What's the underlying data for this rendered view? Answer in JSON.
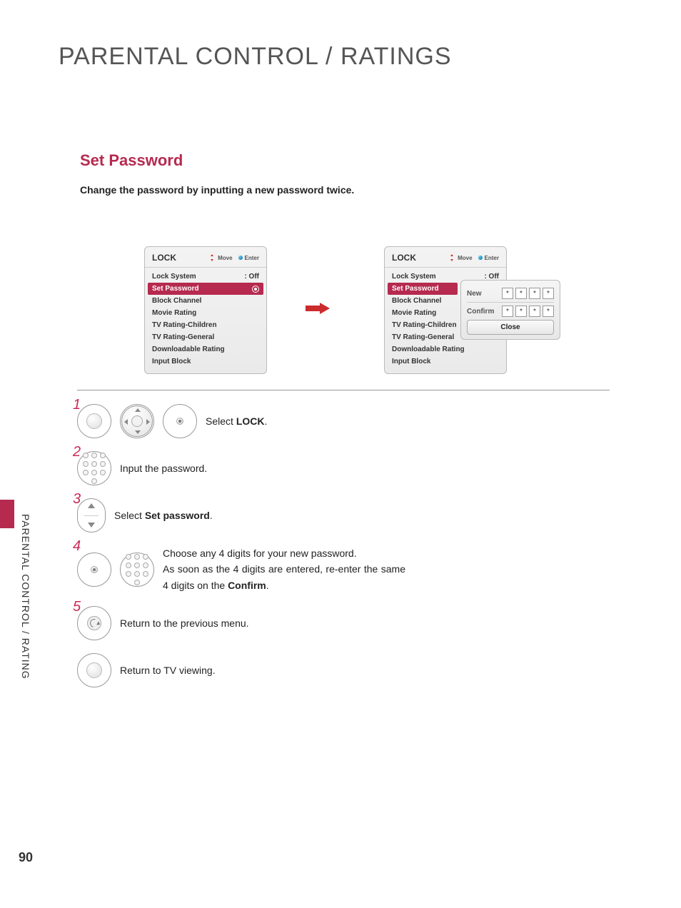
{
  "page": {
    "title": "PARENTAL CONTROL / RATINGS",
    "section_title": "Set Password",
    "section_desc": "Change the password by inputting a new password twice.",
    "side_label": "PARENTAL CONTROL / RATING",
    "number": "90"
  },
  "menu_left": {
    "title": "LOCK",
    "hint_move": "Move",
    "hint_enter": "Enter",
    "rows": {
      "lock_system_label": "Lock System",
      "lock_system_value": ": Off",
      "set_password": "Set Password",
      "block_channel": "Block Channel",
      "movie_rating": "Movie Rating",
      "tv_rating_children": "TV Rating-Children",
      "tv_rating_general": "TV Rating-General",
      "downloadable_rating": "Downloadable Rating",
      "input_block": "Input Block"
    }
  },
  "menu_right": {
    "title": "LOCK",
    "hint_move": "Move",
    "hint_enter": "Enter",
    "rows": {
      "lock_system_label": "Lock System",
      "lock_system_value": ": Off",
      "set_password": "Set Password",
      "block_channel": "Block Channel",
      "movie_rating": "Movie Rating",
      "tv_rating_children": "TV Rating-Children",
      "tv_rating_general": "TV Rating-General",
      "downloadable_rating": "Downloadable Rating",
      "input_block": "Input Block"
    }
  },
  "popup": {
    "new_label": "New",
    "confirm_label": "Confirm",
    "digit_new": [
      "*",
      "*",
      "*",
      "*"
    ],
    "digit_confirm": [
      "*",
      "*",
      "*",
      "*"
    ],
    "close": "Close"
  },
  "steps": {
    "n1": "1",
    "n2": "2",
    "n3": "3",
    "n4": "4",
    "n5": "5",
    "s1_pre": "Select ",
    "s1_bold": "LOCK",
    "s1_post": ".",
    "s2": "Input the password.",
    "s3_pre": "Select ",
    "s3_bold": "Set password",
    "s3_post": ".",
    "s4_line1": "Choose any 4 digits for your new password.",
    "s4_line2_pre": "As soon as the 4 digits are entered, re-enter the same 4 digits on the ",
    "s4_line2_bold": "Confirm",
    "s4_line2_post": ".",
    "s5": "Return to the previous menu.",
    "s6": "Return to TV viewing."
  }
}
